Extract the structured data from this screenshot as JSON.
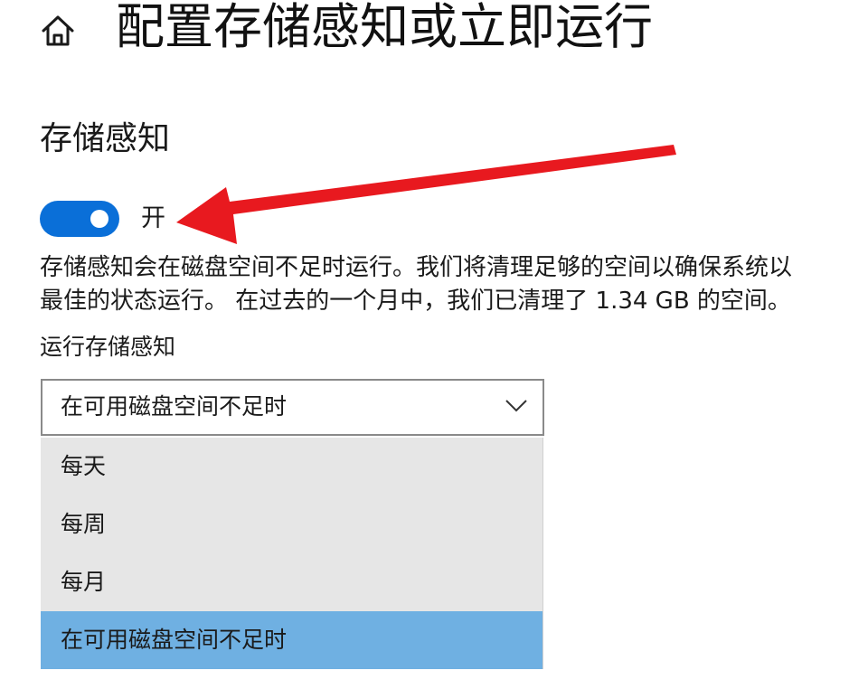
{
  "header": {
    "title": "配置存储感知或立即运行",
    "home_icon": "home-icon"
  },
  "section": {
    "title": "存储感知"
  },
  "toggle": {
    "state_label": "开",
    "on": true,
    "accent_color": "#0a6fd8"
  },
  "description": {
    "line1": "存储感知会在磁盘空间不足时运行。我们将清理足够的空间以确保系统以",
    "line2": "最佳的状态运行。 在过去的一个月中，我们已清理了 1.34 GB 的空间。"
  },
  "run_field": {
    "label": "运行存储感知",
    "selected_value": "在可用磁盘空间不足时",
    "options": [
      "每天",
      "每周",
      "每月",
      "在可用磁盘空间不足时"
    ],
    "selected_index": 3
  },
  "annotation": {
    "arrow_color": "#e8191f",
    "arrow_icon": "red-arrow-icon"
  }
}
